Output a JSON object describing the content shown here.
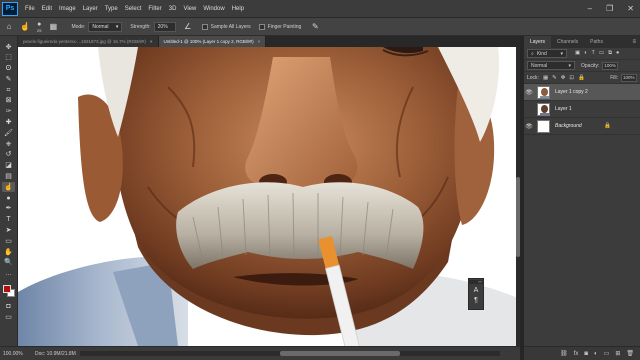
{
  "app": {
    "logo": "Ps"
  },
  "menus": [
    "File",
    "Edit",
    "Image",
    "Layer",
    "Type",
    "Select",
    "Filter",
    "3D",
    "View",
    "Window",
    "Help"
  ],
  "window_controls": {
    "minimize": "–",
    "restore": "❐",
    "close": "✕"
  },
  "options_bar": {
    "brush_size": "25",
    "mode_label": "Mode:",
    "mode_value": "Normal",
    "strength_label": "Strength:",
    "strength_value": "20%",
    "sample_all_layers": "Sample All Layers",
    "finger_painting": "Finger Painting"
  },
  "document_tabs": [
    {
      "label": "pexels-figueiredo-yentersx-...1931873.jpg @ 16.7% (RGB/8#)",
      "active": false
    },
    {
      "label": "Untitled-1 @ 100% (Layer 1 copy 2, RGB/8#)",
      "active": true
    }
  ],
  "tools": [
    "move-tool",
    "marquee-tool",
    "lasso-tool",
    "quick-select-tool",
    "crop-tool",
    "frame-tool",
    "eyedropper-tool",
    "healing-brush-tool",
    "brush-tool",
    "clone-stamp-tool",
    "history-brush-tool",
    "eraser-tool",
    "gradient-tool",
    "smudge-tool",
    "dodge-tool",
    "pen-tool",
    "type-tool",
    "path-select-tool",
    "rectangle-tool",
    "hand-tool",
    "zoom-tool",
    "more-tools"
  ],
  "tool_glyphs": [
    "✥",
    "⬚",
    "ʘ",
    "✎",
    "⌗",
    "⊠",
    "✑",
    "✚",
    "🖌",
    "⎈",
    "↺",
    "◪",
    "▤",
    "☝",
    "●",
    "✒",
    "T",
    "➤",
    "▭",
    "✋",
    "🔍",
    "…"
  ],
  "active_tool": "smudge-tool",
  "colors": {
    "foreground": "#b30f0f",
    "background": "#ffffff",
    "accent": "#31a8ff"
  },
  "status_bar": {
    "zoom": "100.00%",
    "doc": "Doc: 10.9M/21.8M",
    "arrow": "›"
  },
  "layers_panel": {
    "tabs": [
      "Layers",
      "Channels",
      "Paths"
    ],
    "active_tab": "Layers",
    "filter_label": "Kind",
    "blend_mode": "Normal",
    "opacity_label": "Opacity:",
    "opacity_value": "100%",
    "lock_label": "Lock:",
    "fill_label": "Fill:",
    "fill_value": "100%",
    "layers": [
      {
        "name": "Layer 1 copy 2",
        "visible": true,
        "selected": true
      },
      {
        "name": "Layer 1",
        "visible": false,
        "selected": false
      },
      {
        "name": "Background",
        "visible": true,
        "selected": false,
        "locked": true
      }
    ],
    "bottom_icons": [
      "link-icon",
      "fx-icon",
      "mask-icon",
      "adjustment-icon",
      "group-icon",
      "new-layer-icon",
      "trash-icon"
    ],
    "bottom_glyphs": [
      "⛓",
      "fx",
      "◙",
      "◐",
      "▭",
      "⊞",
      "🗑"
    ]
  },
  "floating_panel": {
    "buttons": [
      "A",
      "¶"
    ]
  }
}
